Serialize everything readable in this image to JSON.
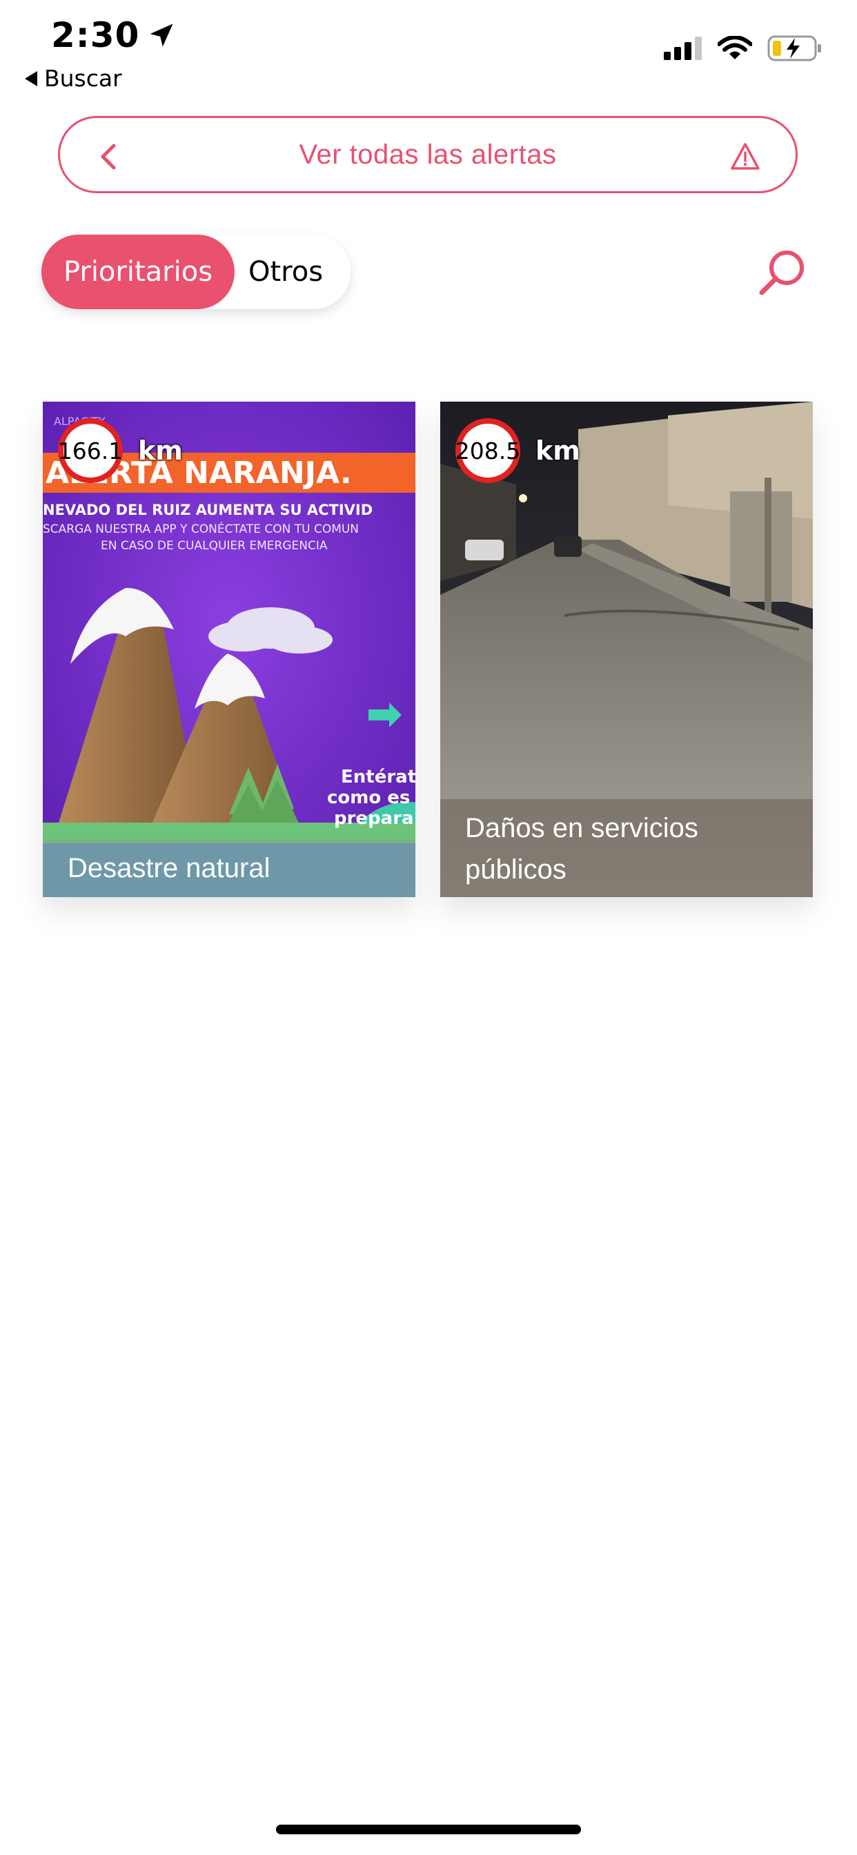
{
  "status_bar": {
    "time": "2:30",
    "back_label": "Buscar"
  },
  "alerts_bar": {
    "label": "Ver todas las alertas"
  },
  "segmented": {
    "active": "Prioritarios",
    "other": "Otros"
  },
  "cards": [
    {
      "distance": "166.1",
      "unit": "km",
      "title": "Desastre natural",
      "art_text": {
        "brand": "ALPACITY",
        "headline": "ALERTA NARANJA.",
        "line1": "NEVADO DEL RUIZ AUMENTA SU ACTIVID",
        "line2": "SCARGA NUESTRA APP Y CONÉCTATE CON TU COMUN",
        "line3": "EN CASO DE CUALQUIER EMERGENCIA",
        "badge1": "Entérat",
        "badge2": "como es",
        "badge3": "prepara"
      }
    },
    {
      "distance": "208.5",
      "unit": "km",
      "title": "Daños en servicios públicos"
    }
  ],
  "colors": {
    "accent": "#e9516e",
    "distance_ring": "#e02222"
  }
}
